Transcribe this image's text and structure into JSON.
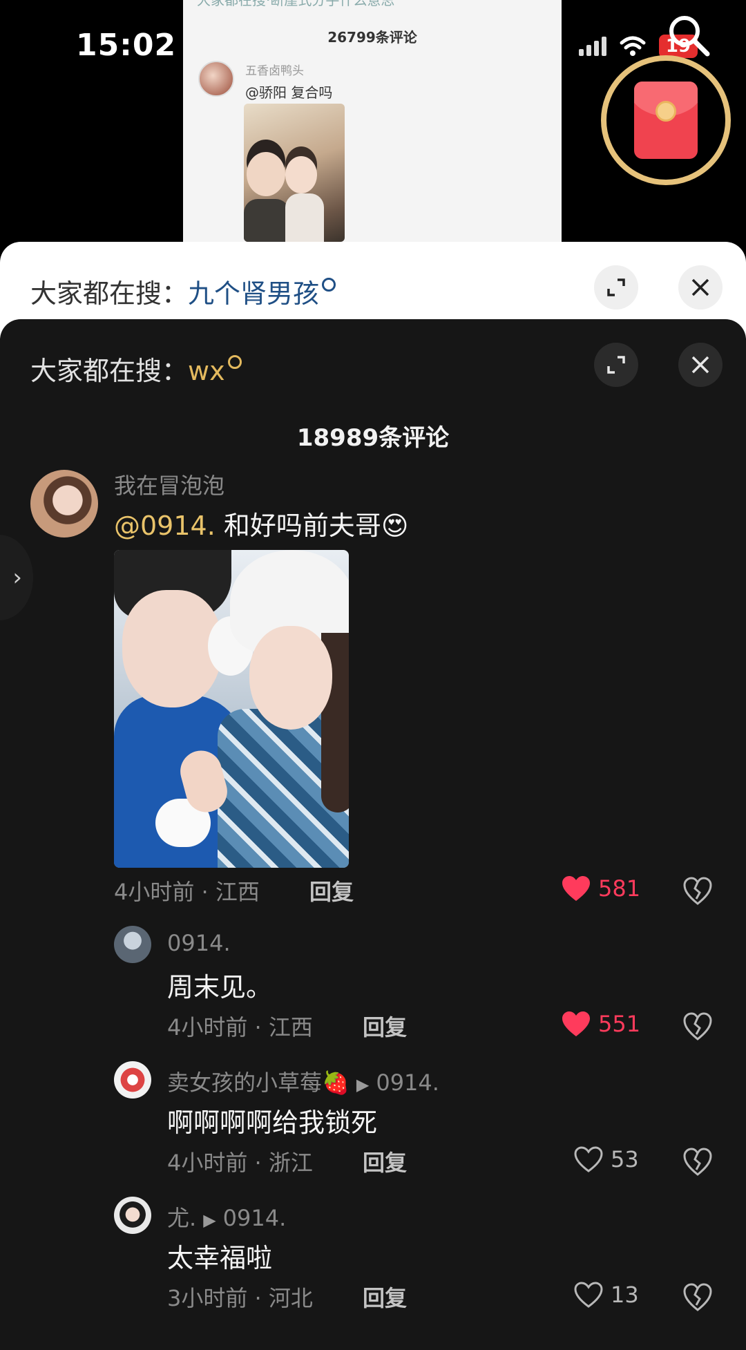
{
  "status_bar": {
    "time": "15:02",
    "battery": "19"
  },
  "background_preview": {
    "top_search_text": "大家都在搜·断崖式分手什么意思",
    "comment_count": "26799条评论",
    "username": "五香卤鸭头",
    "comment": "@骄阳 复合吗"
  },
  "search_panels": [
    {
      "label": "大家都在搜：",
      "keyword": "九个肾男孩"
    },
    {
      "label": "大家都在搜：",
      "keyword": "wx"
    }
  ],
  "comments_title": "18989条评论",
  "comments": [
    {
      "username": "我在冒泡泡",
      "mention": "@0914.",
      "text": " 和好吗前夫哥😍",
      "time_location": "4小时前 · 江西",
      "reply_label": "回复",
      "likes": "581",
      "liked": true
    },
    {
      "username": "0914.",
      "text": "周末见。",
      "time_location": "4小时前 · 江西",
      "reply_label": "回复",
      "likes": "551",
      "liked": true
    },
    {
      "username": "卖女孩的小草莓🍓",
      "reply_to": "0914.",
      "text": "啊啊啊啊给我锁死",
      "time_location": "4小时前 · 浙江",
      "reply_label": "回复",
      "likes": "53",
      "liked": false
    },
    {
      "username": "尤.",
      "reply_to": "0914.",
      "text": "太幸福啦",
      "time_location": "3小时前 · 河北",
      "reply_label": "回复",
      "likes": "13",
      "liked": false
    }
  ],
  "colors": {
    "sheet_bg": "#161616",
    "mention": "#e9c36a",
    "like_active": "#ff3b5c",
    "keyword_dark": "#e3b95e",
    "keyword_light": "#1f4f85"
  },
  "icons": [
    "search-icon",
    "red-packet-icon",
    "expand-icon",
    "close-icon",
    "heart-icon",
    "dislike-icon",
    "chevron-right-icon"
  ]
}
